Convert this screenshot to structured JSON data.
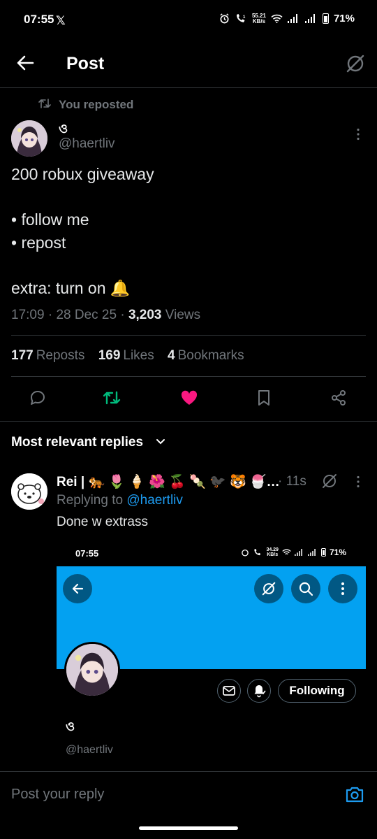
{
  "status_bar": {
    "time": "07:55",
    "x_logo": "𝕏",
    "net_speed_top": "55.21",
    "net_speed_bottom": "KB/s",
    "battery": "71%"
  },
  "header": {
    "title": "Post"
  },
  "repost": {
    "label": "You reposted"
  },
  "author": {
    "name": "ও",
    "handle": "@haertliv"
  },
  "post": {
    "line1": "200 robux giveaway",
    "line2": "• follow me",
    "line3": "• repost",
    "line4": "extra: turn on 🔔",
    "time": "17:09",
    "date": "28 Dec 25",
    "views_count": "3,203",
    "views_label": "Views"
  },
  "stats": {
    "reposts_count": "177",
    "reposts_label": "Reposts",
    "likes_count": "169",
    "likes_label": "Likes",
    "bookmarks_count": "4",
    "bookmarks_label": "Bookmarks"
  },
  "colors": {
    "repost_green": "#00ba7c",
    "like_pink": "#f91880",
    "link_blue": "#1d9bf0",
    "banner_blue": "#03a1f1"
  },
  "sort": {
    "label": "Most relevant replies"
  },
  "reply": {
    "name": "Rei | 🐅 🌷 🍦 🌺 🍒 🍡 🐦‍⬛ 🐯 🍧…",
    "time": "· 11s",
    "replying_prefix": "Replying to",
    "replying_handle": "@haertliv",
    "text": "Done w extrass"
  },
  "embed": {
    "time": "07:55",
    "net_speed_top": "34.29",
    "net_speed_bottom": "KB/s",
    "battery": "71%",
    "following_label": "Following",
    "name": "ও",
    "handle": "@haertliv"
  },
  "compose": {
    "placeholder": "Post your reply"
  }
}
